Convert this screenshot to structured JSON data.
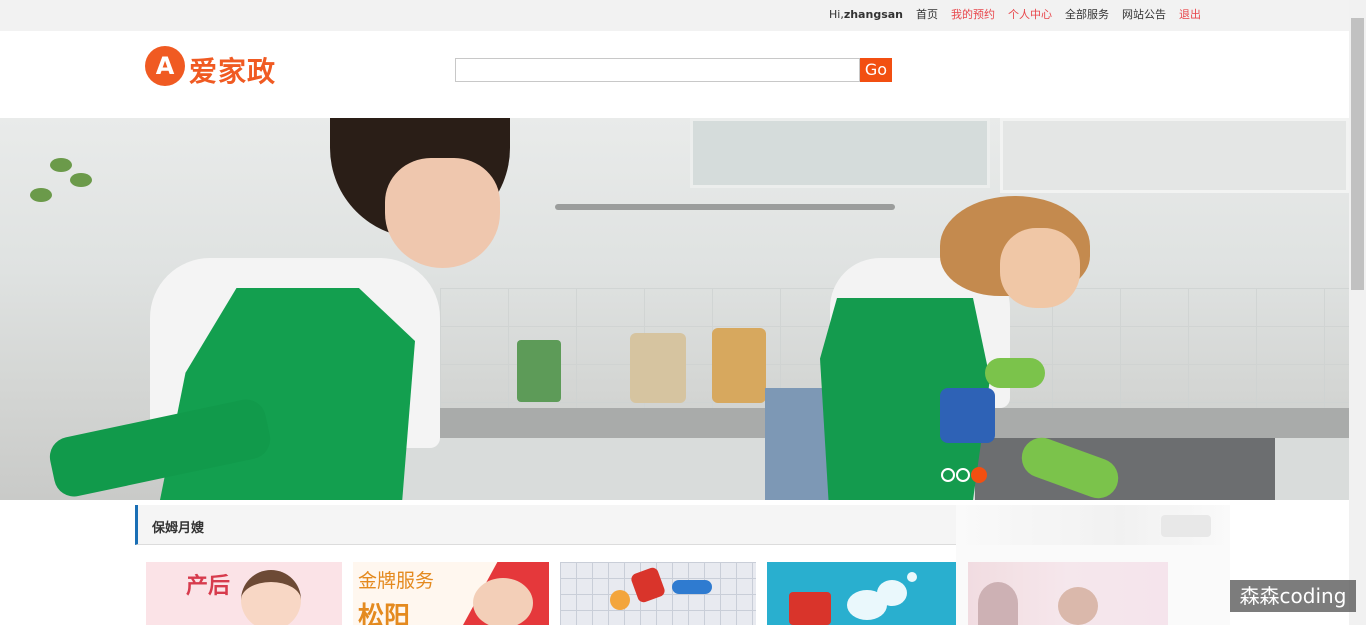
{
  "topbar": {
    "greeting_prefix": "Hi,",
    "username": "zhangsan",
    "links": [
      {
        "label": "首页",
        "color": "#333333"
      },
      {
        "label": "我的预约",
        "color": "#e8474c"
      },
      {
        "label": "个人中心",
        "color": "#e8474c"
      },
      {
        "label": "全部服务",
        "color": "#333333"
      },
      {
        "label": "网站公告",
        "color": "#333333"
      },
      {
        "label": "退出",
        "color": "#e8474c"
      }
    ]
  },
  "header": {
    "logo_letter": "A",
    "logo_text": "爱家政",
    "brand_color": "#f05a22",
    "search": {
      "value": "",
      "placeholder": "",
      "button_label": "Go"
    }
  },
  "banner": {
    "slide_count": 3,
    "active_slide": 3
  },
  "section": {
    "title": "保姆月嫂",
    "accent_color": "#1a6fb5",
    "cards": [
      {
        "text": "产后"
      },
      {
        "text": "金牌服务",
        "subtext": "松阳"
      },
      {
        "text": ""
      },
      {
        "text": ""
      }
    ]
  },
  "watermark": "森森coding"
}
